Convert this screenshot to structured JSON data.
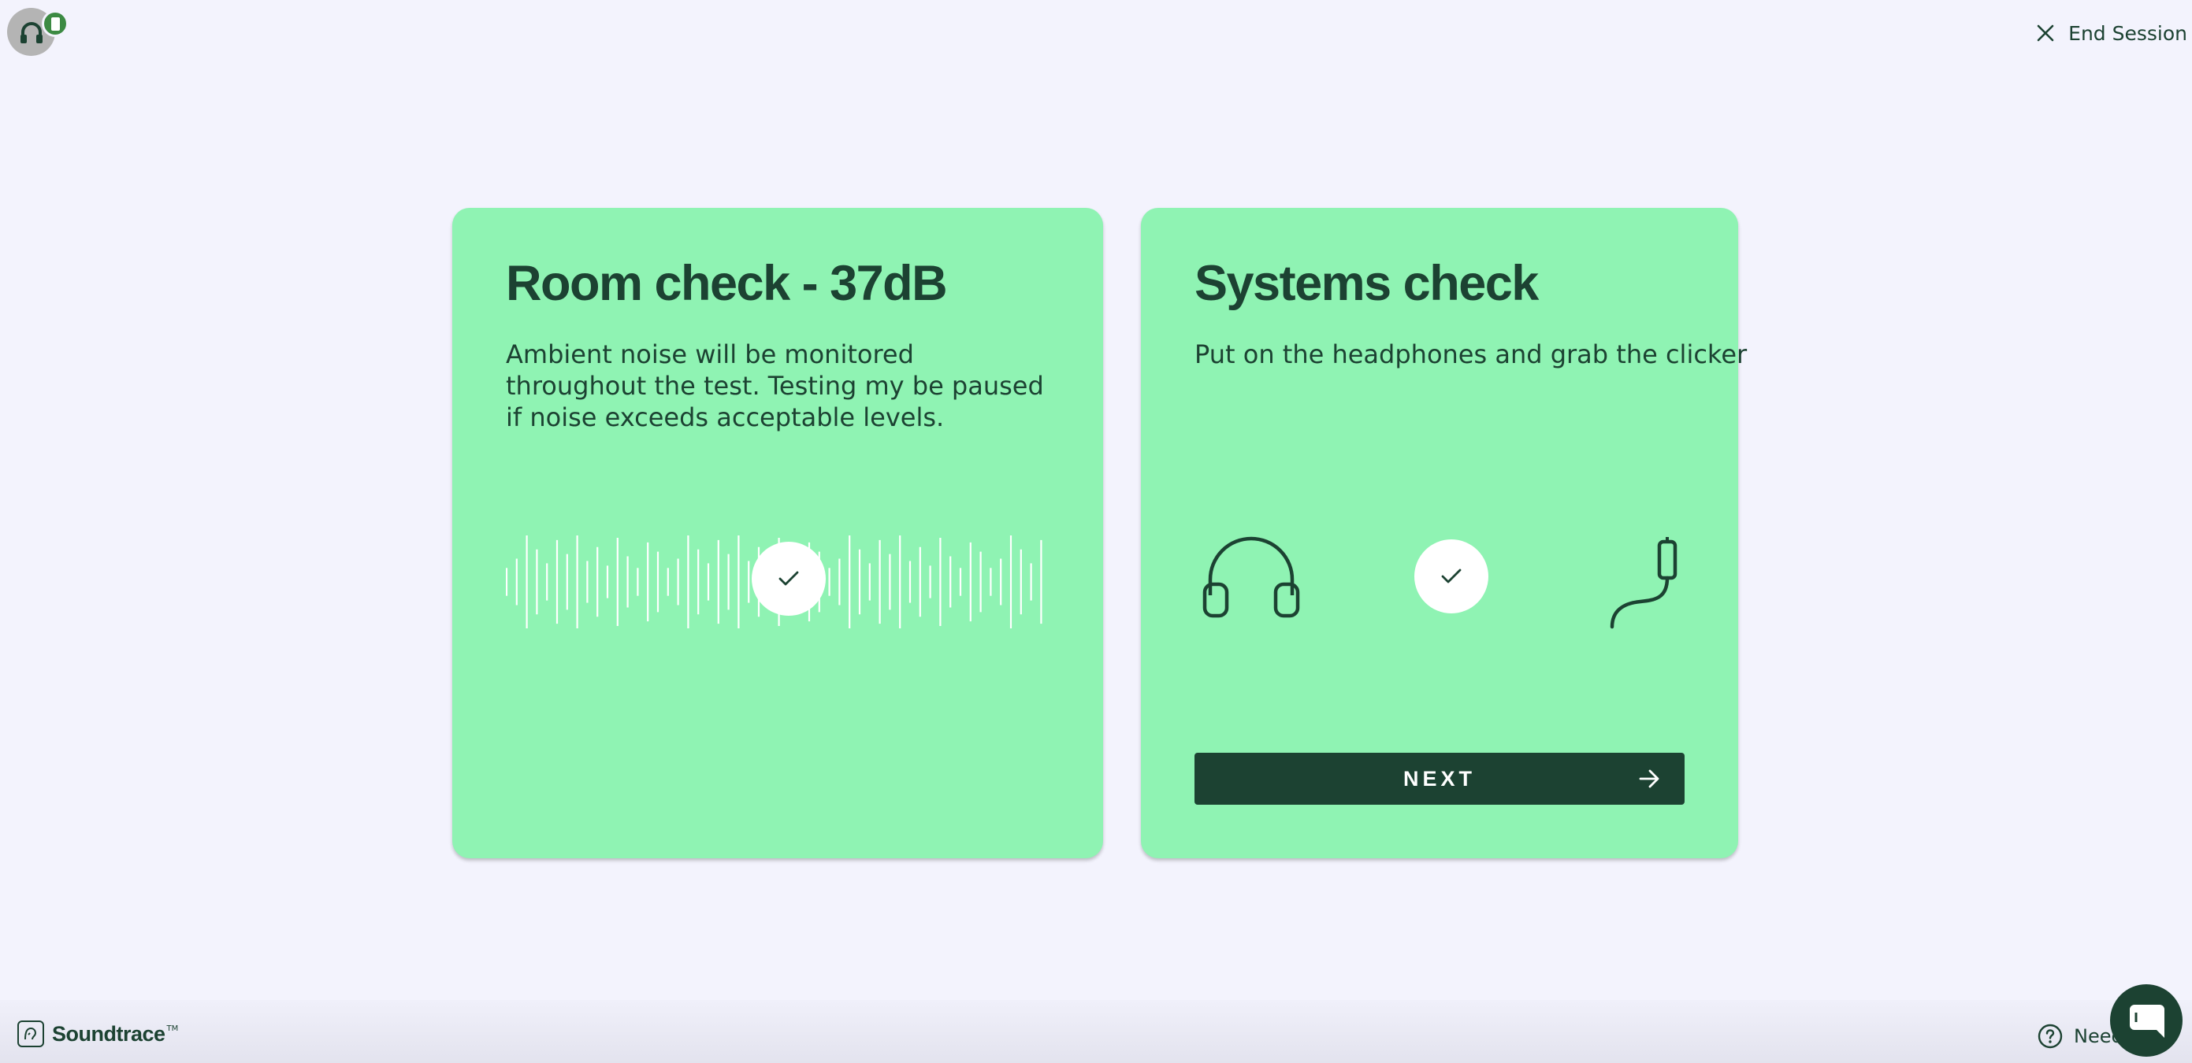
{
  "header": {
    "device_status_icon": "headphones-icon",
    "end_session_label": "End Session"
  },
  "room_check": {
    "title": "Room check - 37dB",
    "description": "Ambient noise will be monitored throughout the test. Testing my be paused if noise exceeds acceptable levels.",
    "status_icon": "check-icon"
  },
  "systems_check": {
    "title": "Systems check",
    "description": "Put on the headphones and grab the clicker",
    "status_icon": "check-icon",
    "next_label": "NEXT"
  },
  "footer": {
    "brand_name": "Soundtrace",
    "brand_mark": "TM",
    "help_label": "Need"
  },
  "colors": {
    "background": "#f3f3fd",
    "card": "#8ff3b3",
    "primary_dark": "#1c4232",
    "status_green": "#3c8a43",
    "avatar_gray": "#b4b4b4"
  }
}
